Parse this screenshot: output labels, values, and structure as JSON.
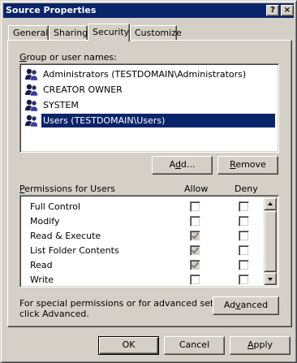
{
  "window": {
    "title": "Source Properties",
    "help_label": "?",
    "close_label": "×"
  },
  "tabs": [
    {
      "label": "General",
      "active": false
    },
    {
      "label": "Sharing",
      "active": false
    },
    {
      "label": "Security",
      "active": true
    },
    {
      "label": "Customize",
      "active": false
    }
  ],
  "group_list": {
    "label_prefix": "G",
    "label_rest": "roup or user names:",
    "items": [
      {
        "name": "Administrators (TESTDOMAIN\\Administrators)",
        "selected": false
      },
      {
        "name": "CREATOR OWNER",
        "selected": false
      },
      {
        "name": "SYSTEM",
        "selected": false
      },
      {
        "name": "Users (TESTDOMAIN\\Users)",
        "selected": true
      }
    ]
  },
  "buttons": {
    "add_a": "A",
    "add_u": "d",
    "add_b": "d...",
    "remove_a": "",
    "remove_u": "R",
    "remove_b": "emove",
    "advanced_a": "Ad",
    "advanced_u": "v",
    "advanced_b": "anced",
    "ok": "OK",
    "cancel": "Cancel",
    "apply_a": "",
    "apply_u": "A",
    "apply_b": "pply"
  },
  "permissions": {
    "label_prefix": "P",
    "label_rest": "ermissions for Users",
    "allow_header": "Allow",
    "deny_header": "Deny",
    "rows": [
      {
        "name": "Full Control",
        "allow": false,
        "allow_disabled": false,
        "deny": false
      },
      {
        "name": "Modify",
        "allow": false,
        "allow_disabled": false,
        "deny": false
      },
      {
        "name": "Read & Execute",
        "allow": true,
        "allow_disabled": true,
        "deny": false
      },
      {
        "name": "List Folder Contents",
        "allow": true,
        "allow_disabled": true,
        "deny": false
      },
      {
        "name": "Read",
        "allow": true,
        "allow_disabled": true,
        "deny": false
      },
      {
        "name": "Write",
        "allow": false,
        "allow_disabled": false,
        "deny": false
      }
    ]
  },
  "special_text_line1": "For special permissions or for advanced settings,",
  "special_text_line2": "click Advanced.",
  "colors": {
    "titlebar": "#0a246a",
    "selection": "#0a246a",
    "face": "#d4d0c8"
  }
}
